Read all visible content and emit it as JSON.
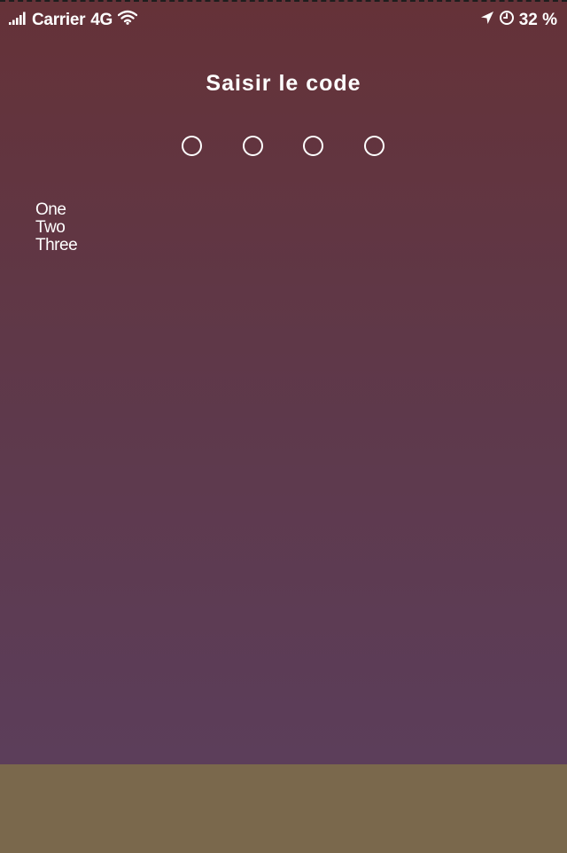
{
  "status_bar": {
    "carrier": "Carrier",
    "network": "4G",
    "battery": "32 %",
    "icons": [
      "signal-bars-icon",
      "wifi-icon",
      "location-arrow-icon",
      "alarm-clock-icon"
    ]
  },
  "title": "Saisir le code",
  "passcode": {
    "length": 4,
    "entered": 0
  },
  "list": {
    "items": [
      "One",
      "Two",
      "Three"
    ]
  },
  "colors": {
    "background_top": "#653238",
    "background_bottom": "#5b3f5e",
    "bottom_area": "#7a684c",
    "foreground": "#ffffff"
  }
}
